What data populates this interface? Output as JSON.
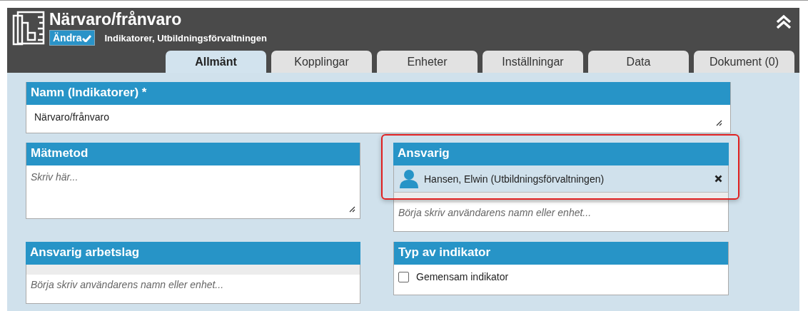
{
  "header": {
    "title": "Närvaro/frånvaro",
    "edit_button": "Ändra",
    "subtitle": "Indikatorer, Utbildningsförvaltningen",
    "collapsed": false
  },
  "tabs": [
    {
      "label": "Allmänt",
      "selected": true
    },
    {
      "label": "Kopplingar",
      "selected": false
    },
    {
      "label": "Enheter",
      "selected": false
    },
    {
      "label": "Inställningar",
      "selected": false
    },
    {
      "label": "Data",
      "selected": false
    },
    {
      "label": "Dokument (0)",
      "selected": false
    }
  ],
  "name_field": {
    "label": "Namn (Indikatorer) *",
    "value": "Närvaro/frånvaro"
  },
  "panels": [
    {
      "kind": "textarea",
      "label": "Mätmetod",
      "placeholder": "Skriv här..."
    },
    {
      "kind": "people",
      "label": "Ansvarig",
      "highlighted": true,
      "people": [
        {
          "name": "Hansen, Elwin (Utbildningsförvaltningen)"
        }
      ],
      "placeholder": "Börja skriv användarens namn eller enhet..."
    },
    {
      "kind": "people",
      "label": "Ansvarig arbetslag",
      "highlighted": false,
      "placeholder": "Börja skriv användarens namn eller enhet..."
    },
    {
      "kind": "checkbox",
      "label": "Typ av indikator",
      "option": "Gemensam indikator",
      "checked": false
    }
  ]
}
